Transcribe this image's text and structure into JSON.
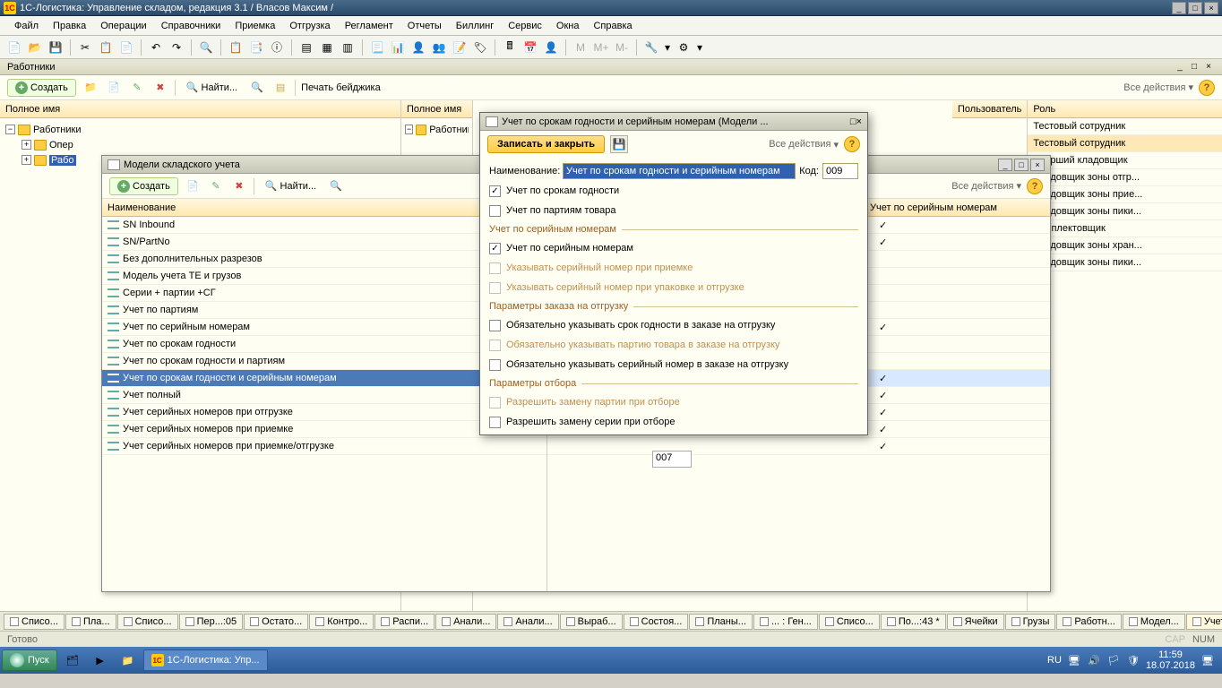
{
  "titlebar": {
    "title": "1С-Логистика: Управление складом, редакция 3.1 / Власов Максим /"
  },
  "menus": [
    "Файл",
    "Правка",
    "Операции",
    "Справочники",
    "Приемка",
    "Отгрузка",
    "Регламент",
    "Отчеты",
    "Биллинг",
    "Сервис",
    "Окна",
    "Справка"
  ],
  "subheader": {
    "title": "Работники"
  },
  "subtoolbar": {
    "create": "Создать",
    "find": "Найти...",
    "print_badge": "Печать бейджика",
    "all_actions": "Все действия"
  },
  "columns": {
    "full_name": "Полное имя",
    "full_name2": "Полное имя",
    "user": "Пользователь",
    "role": "Роль"
  },
  "tree": {
    "root": "Работники",
    "child1": "Опер",
    "child2": "Рабо"
  },
  "roles": [
    "Тестовый сотрудник",
    "Тестовый сотрудник",
    "Старший кладовщик",
    "Кладовщик зоны отгр...",
    "Кладовщик зоны прие...",
    "Кладовщик зоны пики...",
    "Комплектовщик",
    "Кладовщик зоны хран...",
    "Кладовщик зоны пики..."
  ],
  "models_window": {
    "title": "Модели складского учета",
    "create": "Создать",
    "find": "Найти...",
    "all_actions": "Все действия",
    "col_name": "Наименование",
    "col_serial": "Учет по серийным номерам",
    "rows": [
      "SN Inbound",
      "SN/PartNo",
      "Без дополнительных разрезов",
      "Модель учета ТЕ и грузов",
      "Серии + партии +СГ",
      "Учет по партиям",
      "Учет по серийным номерам",
      "Учет по срокам годности",
      "Учет по срокам годности и партиям",
      "Учет по срокам годности и серийным номерам",
      "Учет полный",
      "Учет серийных номеров при отгрузке",
      "Учет серийных номеров при приемке",
      "Учет серийных номеров при приемке/отгрузке"
    ],
    "selected_index": 9,
    "code_007": "007"
  },
  "dialog": {
    "title": "Учет по срокам годности и серийным номерам (Модели ...",
    "save_close": "Записать и закрыть",
    "all_actions": "Все действия",
    "label_name": "Наименование:",
    "name_value": "Учет по срокам годности и серийным номерам",
    "label_code": "Код:",
    "code_value": "009",
    "chk_expiry": "Учет по срокам годности",
    "chk_batches": "Учет по партиям товара",
    "section_serial": "Учет по серийным номерам",
    "chk_serial": "Учет по серийным номерам",
    "chk_serial_receipt": "Указывать серийный номер при приемке",
    "chk_serial_pack": "Указывать серийный номер при упаковке и отгрузке",
    "section_ship": "Параметры заказа на отгрузку",
    "chk_ship_expiry": "Обязательно указывать срок годности в заказе на отгрузку",
    "chk_ship_batch": "Обязательно указывать партию товара в заказе на отгрузку",
    "chk_ship_serial": "Обязательно указывать серийный номер в заказе на отгрузку",
    "section_pick": "Параметры отбора",
    "chk_pick_batch": "Разрешить замену партии при отборе",
    "chk_pick_serial": "Разрешить замену серии при отборе"
  },
  "doc_tabs": [
    "Списо...",
    "Пла...",
    "Списо...",
    "Пер...:05",
    "Остато...",
    "Контро...",
    "Распи...",
    "Анали...",
    "Анали...",
    "Выраб...",
    "Состоя...",
    "Планы...",
    "... : Ген...",
    "Списо...",
    "По...:43 *",
    "Ячейки",
    "Грузы",
    "Работн...",
    "Модел...",
    "Учет п..."
  ],
  "status": {
    "ready": "Готово",
    "cap": "CAP",
    "num": "NUM"
  },
  "taskbar": {
    "start": "Пуск",
    "app": "1С-Логистика: Упр...",
    "lang": "RU",
    "time": "11:59",
    "date": "18.07.2018"
  }
}
